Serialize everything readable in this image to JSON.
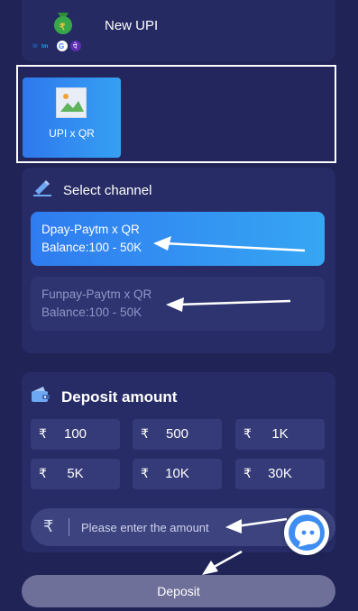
{
  "upi_card": {
    "title": "New UPI",
    "logo_icon": "upi-wallet-logo-icon"
  },
  "payment_method": {
    "label": "UPI x QR",
    "selected": true
  },
  "channel_panel": {
    "title": "Select channel",
    "icon": "pencil-icon",
    "options": [
      {
        "name": "Dpay-Paytm x QR",
        "balance": "Balance:100 - 50K",
        "active": true
      },
      {
        "name": "Funpay-Paytm x QR",
        "balance": "Balance:100 - 50K",
        "active": false
      }
    ]
  },
  "amount_panel": {
    "title": "Deposit amount",
    "icon": "wallet-icon",
    "currency": "₹",
    "presets": [
      "100",
      "500",
      "1K",
      "5K",
      "10K",
      "30K"
    ],
    "input_placeholder": "Please enter the amount"
  },
  "deposit_button": {
    "label": "Deposit"
  },
  "colors": {
    "background": "#1f2356",
    "panel": "#272c66",
    "accent_gradient_start": "#2f7cf0",
    "accent_gradient_end": "#36a6f3",
    "chip": "#353b78",
    "deposit_button": "#6e7099"
  }
}
